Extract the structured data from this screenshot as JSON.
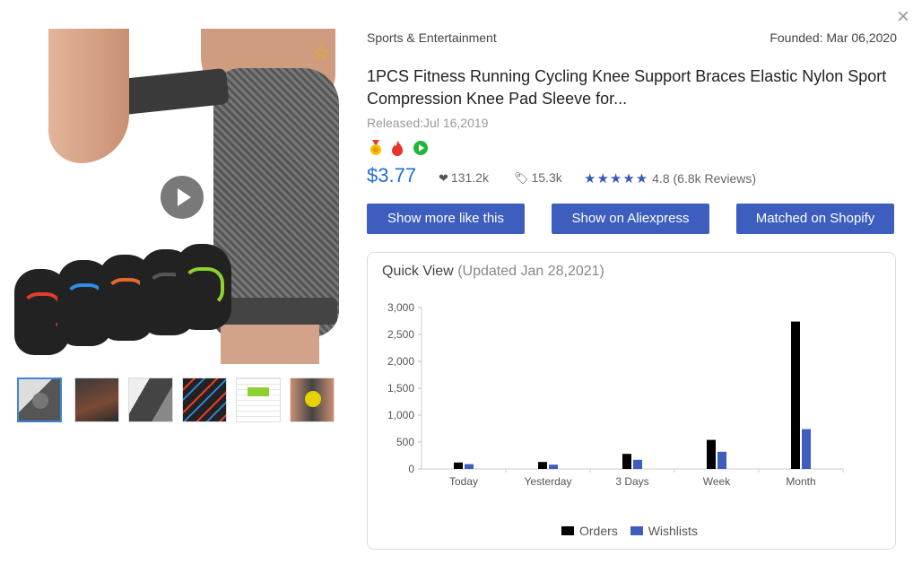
{
  "close_icon": "close-icon",
  "product": {
    "category": "Sports & Entertainment",
    "founded": "Founded: Mar 06,2020",
    "title": "1PCS Fitness Running Cycling Knee Support Braces Elastic Nylon Sport Compression Knee Pad Sleeve for...",
    "released": "Released:Jul 16,2019",
    "price": "$3.77",
    "likes": "131.2k",
    "tags": "15.3k",
    "stars": "★★★★★",
    "rating": "4.8",
    "reviews": "(6.8k Reviews)",
    "badges": [
      "medal-icon",
      "fire-icon",
      "play-circle-icon"
    ]
  },
  "colors": {
    "accent": "#3e5ebf",
    "price": "#1f6fcf",
    "orders": "#000000",
    "wishlists": "#3e5ebf"
  },
  "buttons": {
    "more": "Show more like this",
    "aliexpress": "Show on Aliexpress",
    "shopify": "Matched on Shopify"
  },
  "thumbnails": [
    "thumb-1",
    "thumb-2",
    "thumb-3",
    "thumb-4",
    "thumb-5",
    "thumb-6"
  ],
  "quick_view": {
    "title": "Quick View",
    "updated": "(Updated Jan 28,2021)"
  },
  "chart_data": {
    "type": "bar",
    "categories": [
      "Today",
      "Yesterday",
      "3 Days",
      "Week",
      "Month"
    ],
    "series": [
      {
        "name": "Orders",
        "values": [
          120,
          130,
          280,
          540,
          2740
        ]
      },
      {
        "name": "Wishlists",
        "values": [
          90,
          80,
          170,
          320,
          740
        ]
      }
    ],
    "yticks": [
      "0",
      "500",
      "1,000",
      "1,500",
      "2,000",
      "2,500",
      "3,000"
    ],
    "ylim": [
      0,
      3000
    ],
    "legend": "bottom",
    "grid": false
  }
}
